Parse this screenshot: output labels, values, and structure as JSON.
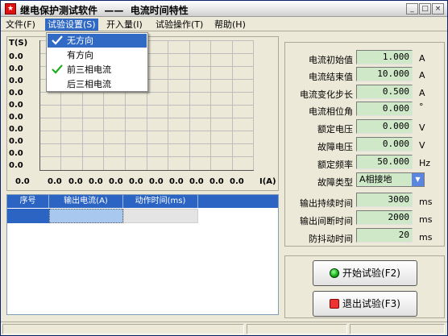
{
  "window": {
    "title": "继电保护测试软件  ——  电流时间特性"
  },
  "menu": [
    {
      "label": "文件(F)"
    },
    {
      "label": "试验设置(S)"
    },
    {
      "label": "开入量(I)"
    },
    {
      "label": "试验操作(T)"
    },
    {
      "label": "帮助(H)"
    }
  ],
  "dropdown": [
    {
      "label": "无方向",
      "checked": true,
      "highlighted": true
    },
    {
      "label": "有方向",
      "checked": false
    },
    {
      "label": "前三相电流",
      "checked": true
    },
    {
      "label": "后三相电流",
      "checked": false
    }
  ],
  "chart": {
    "ylabel": "T(S)",
    "xlabel": "I(A)",
    "yticks": [
      "0.0",
      "0.0",
      "0.0",
      "0.0",
      "0.0",
      "0.0",
      "0.0",
      "0.0",
      "0.0",
      "0.0"
    ],
    "origin": "0.0",
    "xticks": [
      "0.0",
      "0.0",
      "0.0",
      "0.0",
      "0.0",
      "0.0",
      "0.0",
      "0.0",
      "0.0",
      "0.0",
      "0.0"
    ]
  },
  "table": {
    "columns": [
      "序号",
      "输出电流(A)",
      "动作时间(ms)"
    ]
  },
  "params": [
    {
      "label": "电流初始值",
      "value": "1.000",
      "unit": "A"
    },
    {
      "label": "电流结束值",
      "value": "10.000",
      "unit": "A"
    },
    {
      "label": "电流变化步长",
      "value": "0.500",
      "unit": "A"
    },
    {
      "label": "电流相位角",
      "value": "0.000",
      "unit": "°"
    },
    {
      "label": "额定电压",
      "value": "0.000",
      "unit": "V"
    },
    {
      "label": "故障电压",
      "value": "0.000",
      "unit": "V"
    },
    {
      "label": "额定频率",
      "value": "50.000",
      "unit": "Hz"
    }
  ],
  "fault_type": {
    "label": "故障类型",
    "value": "A相接地"
  },
  "timing": [
    {
      "label": "输出持续时间",
      "value": "3000",
      "unit": "ms"
    },
    {
      "label": "输出间断时间",
      "value": "2000",
      "unit": "ms"
    },
    {
      "label": "防抖动时间",
      "value": "20",
      "unit": "ms"
    }
  ],
  "actions": {
    "start_label": "开始试验(F2)",
    "exit_label": "退出试验(F3)"
  },
  "colors": {
    "accent": "#316ac5",
    "input_bg": "#cfe8c8",
    "header_bg": "#2b64c2"
  }
}
